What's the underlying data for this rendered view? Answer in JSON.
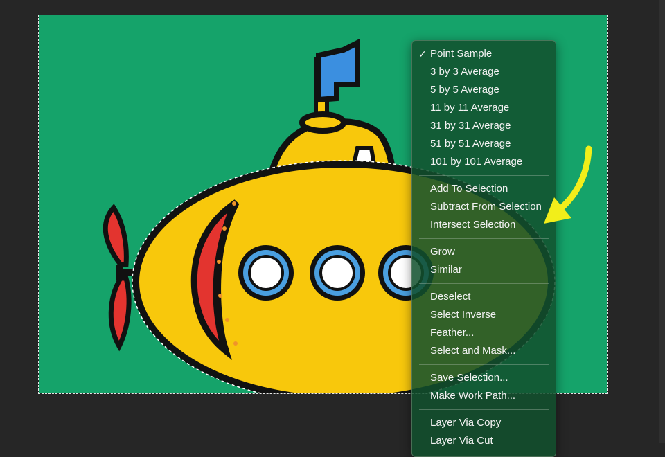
{
  "colors": {
    "workspace_bg": "#262626",
    "canvas_bg": "#15a36a",
    "menu_bg": "#12502d",
    "submarine_body": "#f8c80c",
    "submarine_fin": "#e3342f",
    "flag": "#3b8fe0",
    "porthole_ring": "#4a9fe0",
    "annotation_arrow": "#f2ee1a"
  },
  "context_menu": {
    "sample_items": [
      {
        "label": "Point Sample",
        "checked": true
      },
      {
        "label": "3 by 3 Average",
        "checked": false
      },
      {
        "label": "5 by 5 Average",
        "checked": false
      },
      {
        "label": "11 by 11 Average",
        "checked": false
      },
      {
        "label": "31 by 31 Average",
        "checked": false
      },
      {
        "label": "51 by 51 Average",
        "checked": false
      },
      {
        "label": "101 by 101 Average",
        "checked": false
      }
    ],
    "selection_items": [
      "Add To Selection",
      "Subtract From Selection",
      "Intersect Selection"
    ],
    "grow_items": [
      "Grow",
      "Similar"
    ],
    "edit_items": [
      "Deselect",
      "Select Inverse",
      "Feather...",
      "Select and Mask..."
    ],
    "save_items": [
      "Save Selection...",
      "Make Work Path..."
    ],
    "layer_items": [
      "Layer Via Copy",
      "Layer Via Cut"
    ],
    "check_glyph": "✓"
  },
  "icons": {
    "checkmark": "check-icon",
    "annotation": "yellow-arrow-annotation"
  }
}
